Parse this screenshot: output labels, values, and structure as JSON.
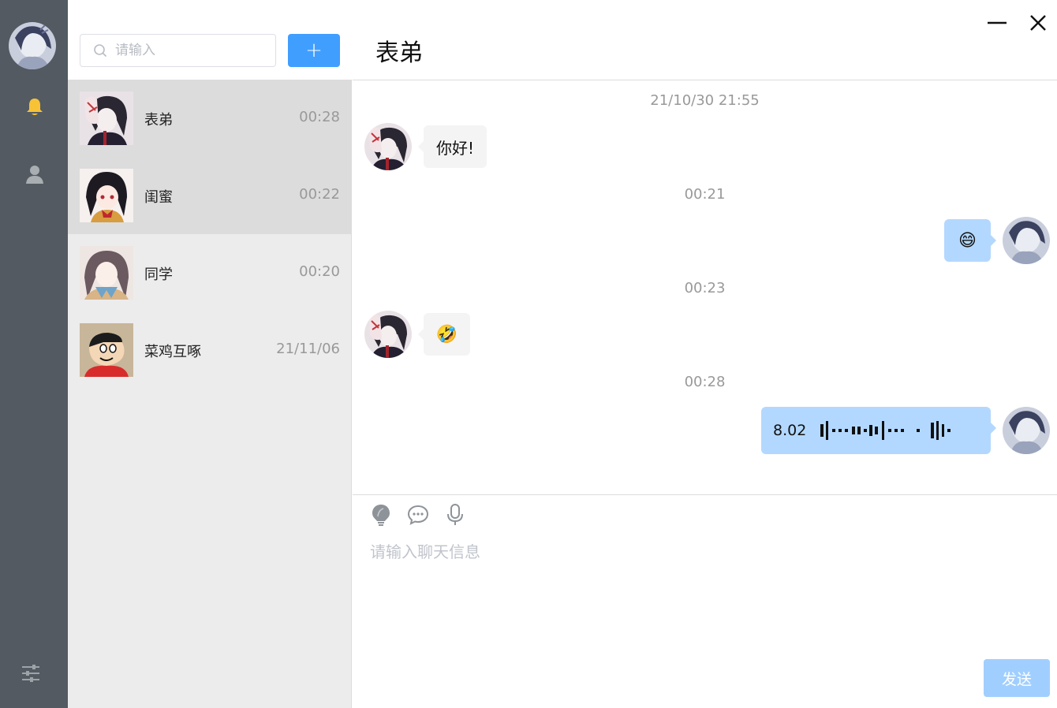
{
  "sidebar": {
    "nav": [
      "bell-icon",
      "user-icon"
    ],
    "active_color": "#f7c236",
    "inactive_color": "#a9aeb3"
  },
  "search": {
    "placeholder": "请输入",
    "add_label": "+"
  },
  "conversations": [
    {
      "name": "表弟",
      "time": "00:28",
      "active": true
    },
    {
      "name": "闺蜜",
      "time": "00:22",
      "active": true
    },
    {
      "name": "同学",
      "time": "00:20",
      "active": false
    },
    {
      "name": "菜鸡互啄",
      "time": "21/11/06",
      "active": false
    }
  ],
  "chat": {
    "title": "表弟",
    "messages": [
      {
        "timestamp": "21/10/30 21:55",
        "side": "left",
        "type": "text",
        "content": "你好!"
      },
      {
        "timestamp": "00:21",
        "side": "right",
        "type": "emoji",
        "content": "😄"
      },
      {
        "timestamp": "00:23",
        "side": "left",
        "type": "emoji",
        "content": "🤣"
      },
      {
        "timestamp": "00:28",
        "side": "right",
        "type": "voice",
        "content": "8.02"
      }
    ]
  },
  "composer": {
    "tools": [
      "bulb-icon",
      "chat-bubble-icon",
      "microphone-icon"
    ],
    "placeholder": "请输入聊天信息",
    "send_label": "发送"
  },
  "colors": {
    "rail": "#535a61",
    "list_bg": "#ececec",
    "active_row": "#dcdcdc",
    "primary": "#409eff",
    "right_bubble": "#b3d8ff",
    "left_bubble": "#f4f4f4",
    "send_disabled": "#a0cfff"
  }
}
